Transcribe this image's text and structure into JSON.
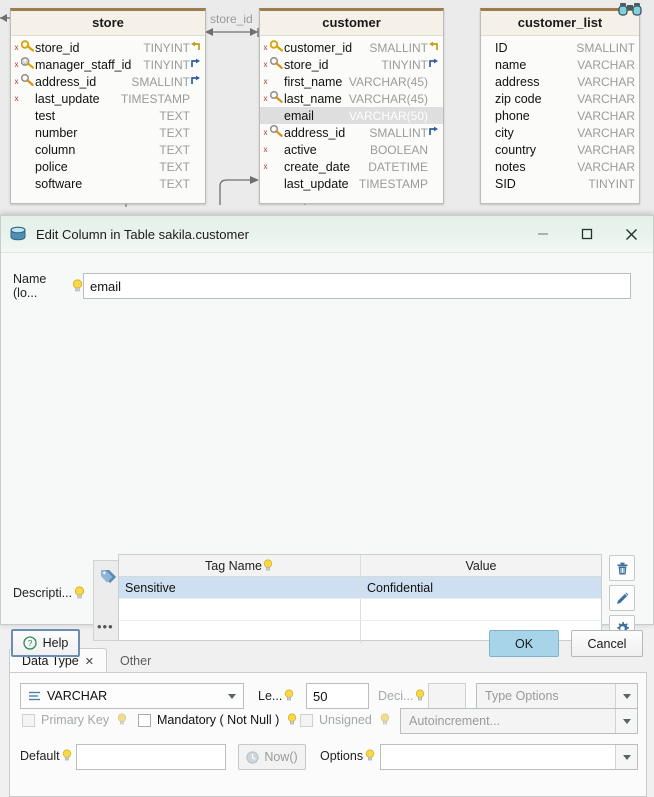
{
  "er_diagram": {
    "relationship_label": "store_id",
    "overview_icon": "binoculars-icon",
    "tables": [
      {
        "name": "store",
        "columns": [
          {
            "name": "store_id",
            "type": "TINYINT",
            "icon": "primary-key-icon",
            "mark": "x",
            "fk": "fk-back-arrow",
            "selected": false
          },
          {
            "name": "manager_staff_id",
            "type": "TINYINT",
            "icon": "unique-key-icon",
            "mark": "x",
            "fk": "fk-arrow",
            "selected": false
          },
          {
            "name": "address_id",
            "type": "SMALLINT",
            "icon": "foreign-key-icon",
            "mark": "x",
            "fk": "fk-arrow",
            "selected": false
          },
          {
            "name": "last_update",
            "type": "TIMESTAMP",
            "icon": "",
            "mark": "x",
            "fk": "",
            "selected": false
          },
          {
            "name": "test",
            "type": "TEXT",
            "icon": "",
            "mark": "",
            "fk": "",
            "selected": false
          },
          {
            "name": "number",
            "type": "TEXT",
            "icon": "",
            "mark": "",
            "fk": "",
            "selected": false
          },
          {
            "name": "column",
            "type": "TEXT",
            "icon": "",
            "mark": "",
            "fk": "",
            "selected": false
          },
          {
            "name": "police",
            "type": "TEXT",
            "icon": "",
            "mark": "",
            "fk": "",
            "selected": false
          },
          {
            "name": "software",
            "type": "TEXT",
            "icon": "",
            "mark": "",
            "fk": "",
            "selected": false
          }
        ]
      },
      {
        "name": "customer",
        "columns": [
          {
            "name": "customer_id",
            "type": "SMALLINT",
            "icon": "primary-key-icon",
            "mark": "x",
            "fk": "fk-back-arrow",
            "selected": false
          },
          {
            "name": "store_id",
            "type": "TINYINT",
            "icon": "foreign-key-icon",
            "mark": "x",
            "fk": "fk-arrow",
            "selected": false
          },
          {
            "name": "first_name",
            "type": "VARCHAR(45)",
            "icon": "",
            "mark": "x",
            "fk": "",
            "selected": false
          },
          {
            "name": "last_name",
            "type": "VARCHAR(45)",
            "icon": "foreign-key-icon",
            "mark": "x",
            "fk": "",
            "selected": false
          },
          {
            "name": "email",
            "type": "VARCHAR(50)",
            "icon": "",
            "mark": "",
            "fk": "",
            "selected": true
          },
          {
            "name": "address_id",
            "type": "SMALLINT",
            "icon": "foreign-key-icon",
            "mark": "x",
            "fk": "fk-arrow",
            "selected": false
          },
          {
            "name": "active",
            "type": "BOOLEAN",
            "icon": "",
            "mark": "x",
            "fk": "",
            "selected": false
          },
          {
            "name": "create_date",
            "type": "DATETIME",
            "icon": "",
            "mark": "x",
            "fk": "",
            "selected": false
          },
          {
            "name": "last_update",
            "type": "TIMESTAMP",
            "icon": "",
            "mark": "",
            "fk": "",
            "selected": false
          }
        ]
      },
      {
        "name": "customer_list",
        "columns": [
          {
            "name": "ID",
            "type": "SMALLINT",
            "icon": "",
            "mark": "",
            "fk": "",
            "selected": false
          },
          {
            "name": "name",
            "type": "VARCHAR",
            "icon": "",
            "mark": "",
            "fk": "",
            "selected": false
          },
          {
            "name": "address",
            "type": "VARCHAR",
            "icon": "",
            "mark": "",
            "fk": "",
            "selected": false
          },
          {
            "name": "zip code",
            "type": "VARCHAR",
            "icon": "",
            "mark": "",
            "fk": "",
            "selected": false
          },
          {
            "name": "phone",
            "type": "VARCHAR",
            "icon": "",
            "mark": "",
            "fk": "",
            "selected": false
          },
          {
            "name": "city",
            "type": "VARCHAR",
            "icon": "",
            "mark": "",
            "fk": "",
            "selected": false
          },
          {
            "name": "country",
            "type": "VARCHAR",
            "icon": "",
            "mark": "",
            "fk": "",
            "selected": false
          },
          {
            "name": "notes",
            "type": "VARCHAR",
            "icon": "",
            "mark": "",
            "fk": "",
            "selected": false
          },
          {
            "name": "SID",
            "type": "TINYINT",
            "icon": "",
            "mark": "",
            "fk": "",
            "selected": false
          }
        ]
      }
    ]
  },
  "dialog": {
    "title": "Edit Column in Table sakila.customer",
    "icon": "database-column-icon",
    "window_controls": {
      "minimize": "–",
      "maximize": "☐",
      "close": "✕"
    },
    "name_field": {
      "label": "Name (lo...",
      "value": "email",
      "placeholder": ""
    },
    "description": {
      "label": "Descripti...",
      "tag_icon": "tags-icon",
      "more_label": "•••",
      "columns": [
        "Tag Name",
        "Value"
      ],
      "rows": [
        {
          "tag_name": "Sensitive",
          "value": "Confidential",
          "selected": true
        },
        {
          "tag_name": "",
          "value": "",
          "selected": false
        },
        {
          "tag_name": "",
          "value": "",
          "selected": false
        }
      ],
      "actions": [
        {
          "name": "delete-tag-button",
          "icon": "trash-icon"
        },
        {
          "name": "edit-tag-button",
          "icon": "pencil-icon"
        },
        {
          "name": "tag-settings-button",
          "icon": "gear-icon"
        }
      ]
    },
    "tabs": [
      {
        "label": "Data Type",
        "active": true,
        "closable": true,
        "close_glyph": "✕"
      },
      {
        "label": "Other",
        "active": false,
        "closable": false,
        "close_glyph": ""
      }
    ],
    "data_type_panel": {
      "type_combo": {
        "value": "VARCHAR",
        "icon": "list-icon"
      },
      "length": {
        "label": "Le...",
        "value": "50"
      },
      "decimals": {
        "label": "Deci...",
        "value": "",
        "disabled": true
      },
      "type_options": {
        "placeholder": "Type Options",
        "value": "",
        "disabled": true
      },
      "primary_key": {
        "label": "Primary Key",
        "checked": false,
        "disabled": true
      },
      "mandatory": {
        "label": "Mandatory ( Not Null )",
        "checked": false,
        "disabled": false
      },
      "unsigned": {
        "label": "Unsigned",
        "checked": false,
        "disabled": true
      },
      "autoincrement": {
        "placeholder": "Autoincrement...",
        "value": "",
        "disabled": true
      },
      "default": {
        "label": "Default",
        "value": "",
        "placeholder": ""
      },
      "now_button": {
        "label": "Now()",
        "icon": "clock-icon",
        "disabled": true
      },
      "options": {
        "label": "Options",
        "value": ""
      }
    },
    "footer": {
      "help": {
        "label": "Help",
        "icon": "question-circle-icon"
      },
      "ok": {
        "label": "OK"
      },
      "cancel": {
        "label": "Cancel"
      }
    }
  },
  "colors": {
    "titlebar": "#e7f2ec",
    "table_header_accent": "#9c7b4f",
    "selected_row": "#cfdff2",
    "primary_button": "#a8d4ea",
    "icon_blue": "#3c6e9f",
    "bulb_yellow": "#f5d34b",
    "type_text": "#9b9b9b"
  }
}
